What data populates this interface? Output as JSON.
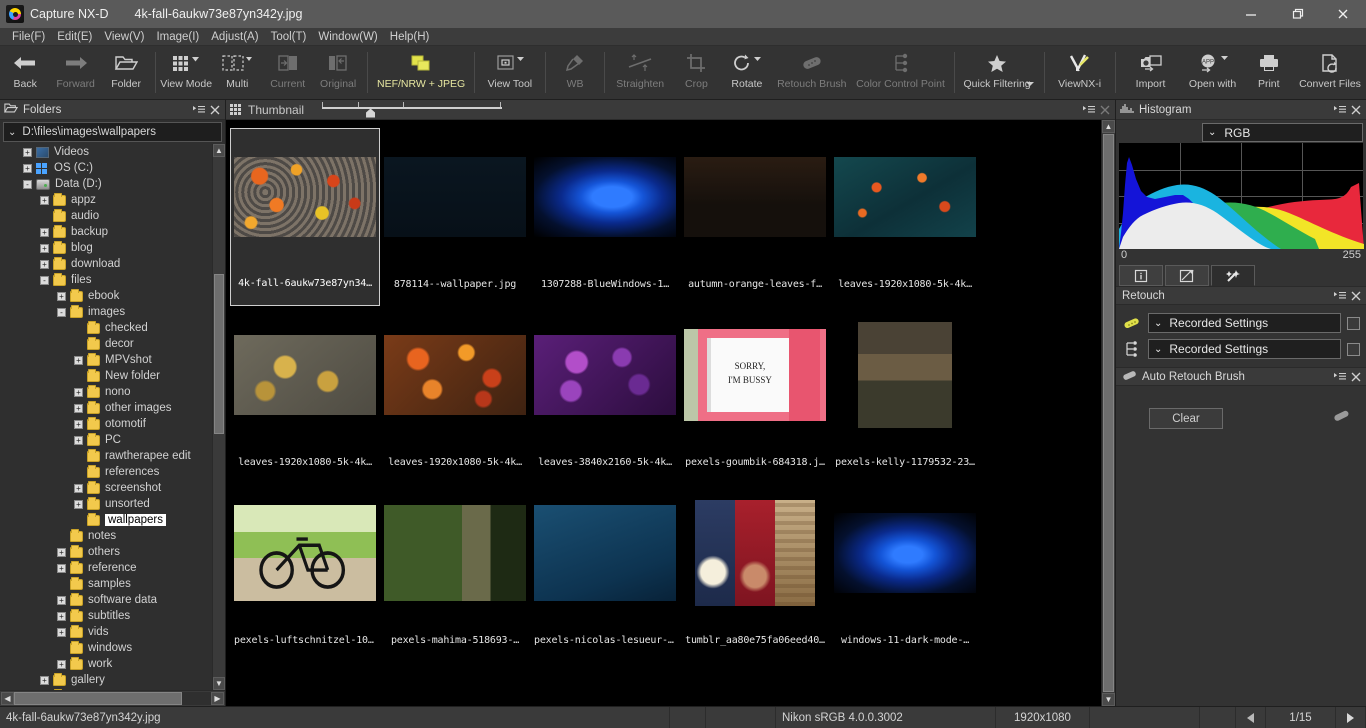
{
  "titlebar": {
    "app_name": "Capture NX-D",
    "file_name": "4k-fall-6aukw73e87yn342y.jpg",
    "minimize": "—",
    "maximize": "❐",
    "close": "✕"
  },
  "menubar": {
    "items": [
      {
        "label": "File(F)"
      },
      {
        "label": "Edit(E)"
      },
      {
        "label": "View(V)"
      },
      {
        "label": "Image(I)"
      },
      {
        "label": "Adjust(A)"
      },
      {
        "label": "Tool(T)"
      },
      {
        "label": "Window(W)"
      },
      {
        "label": "Help(H)"
      }
    ]
  },
  "toolbar": {
    "items": [
      {
        "label": "Back",
        "icon": "arrow-left-icon",
        "state": "enabled"
      },
      {
        "label": "Forward",
        "icon": "arrow-right-icon",
        "state": "disabled"
      },
      {
        "label": "Folder",
        "icon": "folder-open-icon",
        "state": "enabled"
      },
      {
        "label": "View Mode",
        "icon": "grid-icon",
        "state": "enabled"
      },
      {
        "label": "Multi",
        "icon": "multi-select-icon",
        "state": "enabled"
      },
      {
        "label": "Current",
        "icon": "current-image-icon",
        "state": "disabled"
      },
      {
        "label": "Original",
        "icon": "original-image-icon",
        "state": "disabled"
      },
      {
        "label": "NEF/NRW + JPEG",
        "icon": "nef-jpeg-icon",
        "state": "highlighted"
      },
      {
        "label": "View Tool",
        "icon": "view-tool-icon",
        "state": "enabled"
      },
      {
        "label": "WB",
        "icon": "eyedropper-icon",
        "state": "disabled"
      },
      {
        "label": "Straighten",
        "icon": "straighten-icon",
        "state": "disabled"
      },
      {
        "label": "Crop",
        "icon": "crop-icon",
        "state": "disabled"
      },
      {
        "label": "Rotate",
        "icon": "rotate-icon",
        "state": "enabled"
      },
      {
        "label": "Retouch Brush",
        "icon": "retouch-brush-icon",
        "state": "disabled"
      },
      {
        "label": "Color Control Point",
        "icon": "color-control-point-icon",
        "state": "disabled"
      },
      {
        "label": "Quick Filtering",
        "icon": "star-icon",
        "state": "enabled"
      },
      {
        "label": "ViewNX-i",
        "icon": "viewnx-icon",
        "state": "enabled"
      },
      {
        "label": "Import",
        "icon": "import-camera-icon",
        "state": "enabled"
      },
      {
        "label": "Open with",
        "icon": "open-with-app-icon",
        "state": "enabled"
      },
      {
        "label": "Print",
        "icon": "printer-icon",
        "state": "enabled"
      },
      {
        "label": "Convert Files",
        "icon": "convert-files-icon",
        "state": "enabled"
      }
    ]
  },
  "folders_panel": {
    "title": "Folders",
    "path": "D:\\files\\images\\wallpapers",
    "tree": [
      {
        "label": "Videos",
        "indent": 1,
        "expander": "+",
        "icon": "videos-icon",
        "selected": false
      },
      {
        "label": "OS (C:)",
        "indent": 1,
        "expander": "+",
        "icon": "pc-icon",
        "selected": false
      },
      {
        "label": "Data (D:)",
        "indent": 1,
        "expander": "-",
        "icon": "drive-icon",
        "selected": false
      },
      {
        "label": "appz",
        "indent": 2,
        "expander": "+",
        "icon": "folder-icon",
        "selected": false
      },
      {
        "label": "audio",
        "indent": 2,
        "expander": "",
        "icon": "folder-icon",
        "selected": false
      },
      {
        "label": "backup",
        "indent": 2,
        "expander": "+",
        "icon": "folder-icon",
        "selected": false
      },
      {
        "label": "blog",
        "indent": 2,
        "expander": "+",
        "icon": "folder-icon",
        "selected": false
      },
      {
        "label": "download",
        "indent": 2,
        "expander": "+",
        "icon": "folder-icon",
        "selected": false
      },
      {
        "label": "files",
        "indent": 2,
        "expander": "-",
        "icon": "folder-icon",
        "selected": false
      },
      {
        "label": "ebook",
        "indent": 3,
        "expander": "+",
        "icon": "folder-icon",
        "selected": false
      },
      {
        "label": "images",
        "indent": 3,
        "expander": "-",
        "icon": "folder-icon",
        "selected": false
      },
      {
        "label": "checked",
        "indent": 4,
        "expander": "",
        "icon": "folder-icon",
        "selected": false
      },
      {
        "label": "decor",
        "indent": 4,
        "expander": "",
        "icon": "folder-icon",
        "selected": false
      },
      {
        "label": "MPVshot",
        "indent": 4,
        "expander": "+",
        "icon": "folder-icon",
        "selected": false
      },
      {
        "label": "New folder",
        "indent": 4,
        "expander": "",
        "icon": "folder-icon",
        "selected": false
      },
      {
        "label": "nono",
        "indent": 4,
        "expander": "+",
        "icon": "folder-icon",
        "selected": false
      },
      {
        "label": "other images",
        "indent": 4,
        "expander": "+",
        "icon": "folder-icon",
        "selected": false
      },
      {
        "label": "otomotif",
        "indent": 4,
        "expander": "+",
        "icon": "folder-icon",
        "selected": false
      },
      {
        "label": "PC",
        "indent": 4,
        "expander": "+",
        "icon": "folder-icon",
        "selected": false
      },
      {
        "label": "rawtherapee edit",
        "indent": 4,
        "expander": "",
        "icon": "folder-icon",
        "selected": false
      },
      {
        "label": "references",
        "indent": 4,
        "expander": "",
        "icon": "folder-icon",
        "selected": false
      },
      {
        "label": "screenshot",
        "indent": 4,
        "expander": "+",
        "icon": "folder-icon",
        "selected": false
      },
      {
        "label": "unsorted",
        "indent": 4,
        "expander": "+",
        "icon": "folder-icon",
        "selected": false
      },
      {
        "label": "wallpapers",
        "indent": 4,
        "expander": "",
        "icon": "folder-icon",
        "selected": true
      },
      {
        "label": "notes",
        "indent": 3,
        "expander": "",
        "icon": "folder-icon",
        "selected": false
      },
      {
        "label": "others",
        "indent": 3,
        "expander": "+",
        "icon": "folder-icon",
        "selected": false
      },
      {
        "label": "reference",
        "indent": 3,
        "expander": "+",
        "icon": "folder-icon",
        "selected": false
      },
      {
        "label": "samples",
        "indent": 3,
        "expander": "",
        "icon": "folder-icon",
        "selected": false
      },
      {
        "label": "software data",
        "indent": 3,
        "expander": "+",
        "icon": "folder-icon",
        "selected": false
      },
      {
        "label": "subtitles",
        "indent": 3,
        "expander": "+",
        "icon": "folder-icon",
        "selected": false
      },
      {
        "label": "vids",
        "indent": 3,
        "expander": "+",
        "icon": "folder-icon",
        "selected": false
      },
      {
        "label": "windows",
        "indent": 3,
        "expander": "",
        "icon": "folder-icon",
        "selected": false
      },
      {
        "label": "work",
        "indent": 3,
        "expander": "+",
        "icon": "folder-icon",
        "selected": false
      },
      {
        "label": "gallery",
        "indent": 2,
        "expander": "+",
        "icon": "folder-icon",
        "selected": false
      },
      {
        "label": "IDrive",
        "indent": 2,
        "expander": "+",
        "icon": "folder-icon",
        "selected": false
      }
    ]
  },
  "thumbnail_panel": {
    "title": "Thumbnail",
    "items": [
      {
        "caption": "4k-fall-6aukw73e87yn34…",
        "selected": true,
        "image": "autumn-leaves-on-pebbles"
      },
      {
        "caption": "878114--wallpaper.jpg",
        "selected": false,
        "image": "dark-circuit-city"
      },
      {
        "caption": "1307288-BlueWindows-1…",
        "selected": false,
        "image": "blue-ribbon-abstract"
      },
      {
        "caption": "autumn-orange-leaves-f…",
        "selected": false,
        "image": "autumn-forest-path"
      },
      {
        "caption": "leaves-1920x1080-5k-4k…",
        "selected": false,
        "image": "teal-leaves-bokeh"
      },
      {
        "caption": "leaves-1920x1080-5k-4k…",
        "selected": false,
        "image": "yellow-leaves-stone"
      },
      {
        "caption": "leaves-1920x1080-5k-4k…",
        "selected": false,
        "image": "orange-autumn-leaves"
      },
      {
        "caption": "leaves-3840x2160-5k-4k…",
        "selected": false,
        "image": "purple-leaves"
      },
      {
        "caption": "pexels-goumbik-684318.j…",
        "selected": false,
        "image": "sorry-im-bussy-notebook"
      },
      {
        "caption": "pexels-kelly-1179532-23…",
        "selected": false,
        "image": "elderly-woman-portrait"
      },
      {
        "caption": "pexels-luftschnitzel-100…",
        "selected": false,
        "image": "bicycle-forest-path"
      },
      {
        "caption": "pexels-mahima-518693-…",
        "selected": false,
        "image": "green-forest-tree"
      },
      {
        "caption": "pexels-nicolas-lesueur-9…",
        "selected": false,
        "image": "dolphins-ocean"
      },
      {
        "caption": "tumblr_aa80e75fa06eed40…",
        "selected": false,
        "image": "illustration-triptych"
      },
      {
        "caption": "windows-11-dark-mode-…",
        "selected": false,
        "image": "windows11-blue-bloom"
      }
    ]
  },
  "histogram_panel": {
    "title": "Histogram",
    "channel": "RGB",
    "axis_min": "0",
    "axis_max": "255"
  },
  "tabs": [
    {
      "name": "info-tab",
      "icon": "info-icon",
      "active": false
    },
    {
      "name": "edit-tab",
      "icon": "pencil-icon",
      "active": false
    },
    {
      "name": "retouch-tab",
      "icon": "wand-icon",
      "active": true
    }
  ],
  "retouch_panel": {
    "title": "Retouch",
    "rows": [
      {
        "icon": "retouch-brush-icon",
        "value": "Recorded Settings",
        "checked": false
      },
      {
        "icon": "control-point-icon",
        "value": "Recorded Settings",
        "checked": false
      }
    ]
  },
  "auto_retouch_panel": {
    "title": "Auto Retouch Brush",
    "clear_label": "Clear",
    "brush_icon": "eraser-icon"
  },
  "statusbar": {
    "file_name": "4k-fall-6aukw73e87yn342y.jpg",
    "color_profile": "Nikon sRGB 4.0.0.3002",
    "dimensions": "1920x1080",
    "page": "1/15",
    "prev_icon": "triangle-left-icon",
    "next_icon": "triangle-right-icon"
  },
  "colors": {
    "accent_yellow": "#f2c94c",
    "panel_bg": "#333333",
    "titlebar_bg": "#5a5a5a",
    "canvas_bg": "#000000",
    "selection": "#ffffff"
  }
}
